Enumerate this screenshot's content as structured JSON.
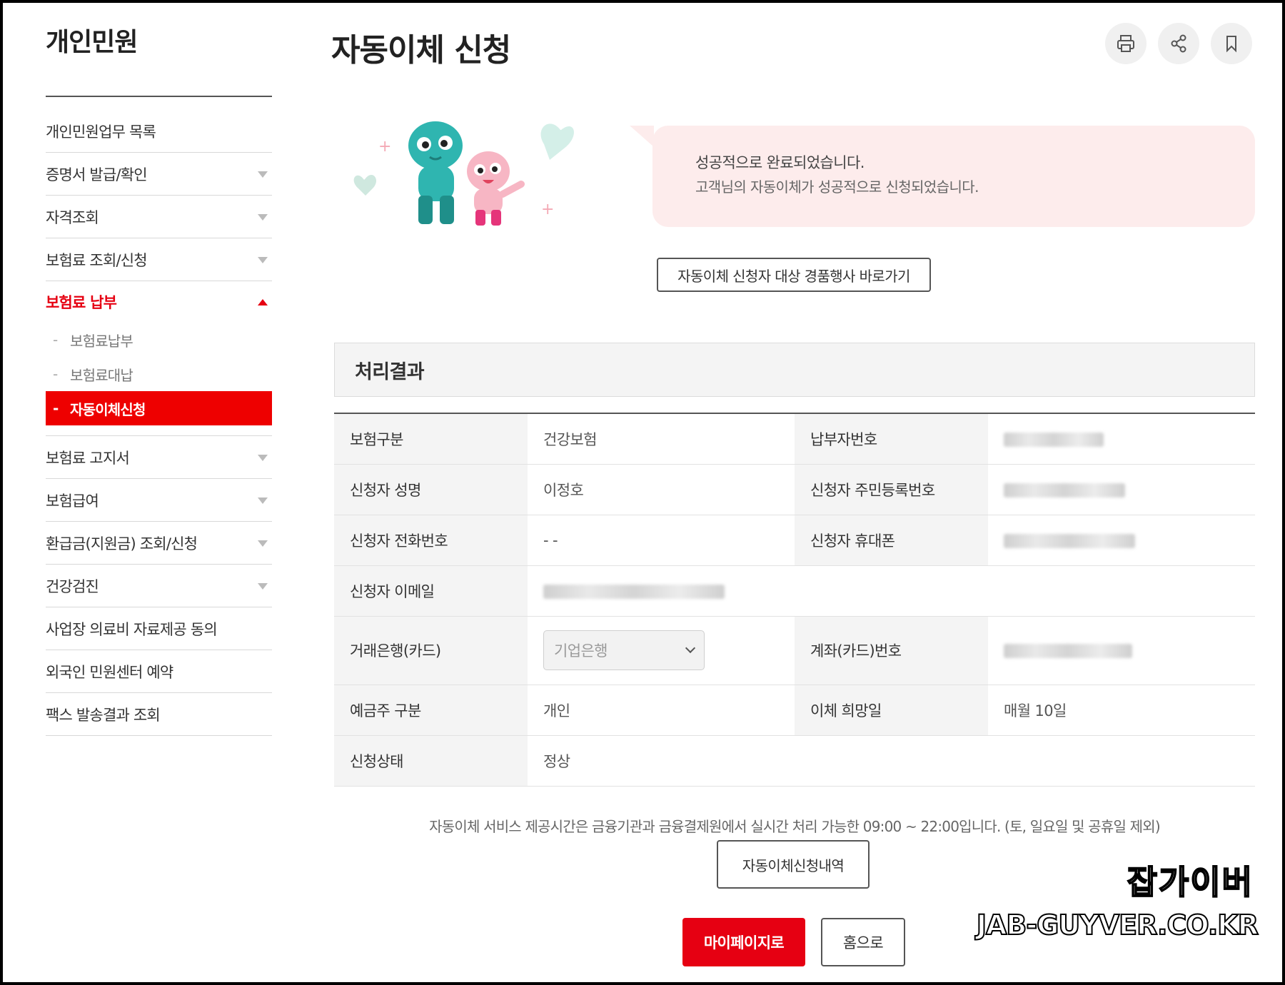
{
  "sidebar": {
    "title": "개인민원",
    "items": [
      {
        "label": "개인민원업무 목록",
        "arrow": false
      },
      {
        "label": "증명서 발급/확인",
        "arrow": true
      },
      {
        "label": "자격조회",
        "arrow": true
      },
      {
        "label": "보험료 조회/신청",
        "arrow": true
      }
    ],
    "active": {
      "label": "보험료 납부",
      "subitems": [
        {
          "label": "보험료납부"
        },
        {
          "label": "보험료대납"
        },
        {
          "label": "자동이체신청"
        }
      ]
    },
    "items_after": [
      {
        "label": "보험료 고지서",
        "arrow": true
      },
      {
        "label": "보험급여",
        "arrow": true
      },
      {
        "label": "환급금(지원금) 조회/신청",
        "arrow": true
      },
      {
        "label": "건강검진",
        "arrow": true
      },
      {
        "label": "사업장 의료비 자료제공 동의",
        "arrow": false
      },
      {
        "label": "외국인 민원센터 예약",
        "arrow": false
      },
      {
        "label": "팩스 발송결과 조회",
        "arrow": false
      }
    ]
  },
  "header": {
    "title": "자동이체 신청",
    "tools": [
      "print-icon",
      "share-icon",
      "bookmark-icon"
    ]
  },
  "banner": {
    "line1": "성공적으로 완료되었습니다.",
    "line2": "고객님의 자동이체가 성공적으로 신청되었습니다.",
    "event_button": "자동이체 신청자 대상 경품행사 바로가기"
  },
  "result": {
    "heading": "처리결과",
    "rows": {
      "insurance_type_label": "보험구분",
      "insurance_type_value": "건강보험",
      "payer_no_label": "납부자번호",
      "applicant_name_label": "신청자 성명",
      "applicant_name_value": "이정호",
      "applicant_rrn_label": "신청자 주민등록번호",
      "applicant_phone_label": "신청자 전화번호",
      "applicant_phone_value": "- -",
      "applicant_mobile_label": "신청자 휴대폰",
      "applicant_email_label": "신청자 이메일",
      "bank_label": "거래은행(카드)",
      "bank_value": "기업은행",
      "account_label": "계좌(카드)번호",
      "holder_type_label": "예금주 구분",
      "holder_type_value": "개인",
      "transfer_day_label": "이체 희망일",
      "transfer_day_value": "매월 10일",
      "status_label": "신청상태",
      "status_value": "정상"
    }
  },
  "notice": "자동이체 서비스 제공시간은 금융기관과 금융결제원에서 실시간 처리 가능한 09:00 ~ 22:00입니다. (토, 일요일 및 공휴일 제외)",
  "buttons": {
    "history": "자동이체신청내역",
    "mypage": "마이페이지로",
    "home": "홈으로"
  },
  "watermark": {
    "line1": "잡가이버",
    "line2": "JAB-GUYVER.CO.KR"
  },
  "colors": {
    "accent": "#e60012",
    "banner_bg": "#fdecec"
  }
}
